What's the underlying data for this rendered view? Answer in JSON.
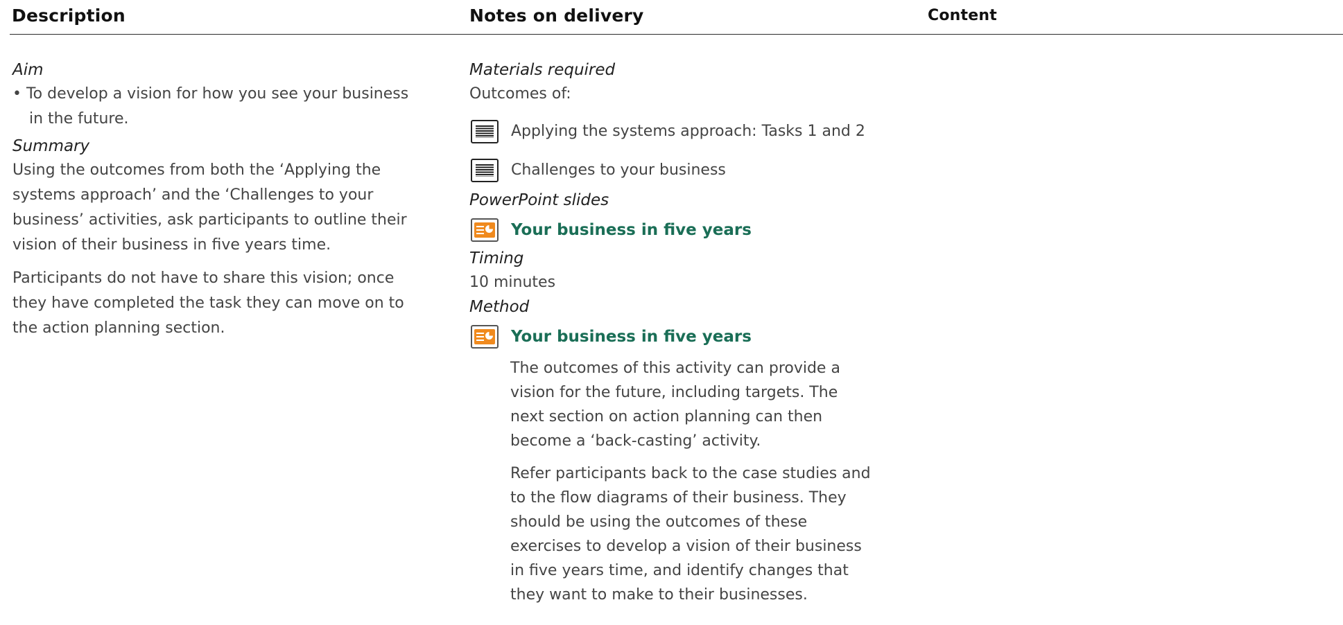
{
  "headers": {
    "description": "Description",
    "notes": "Notes on delivery",
    "content": "Content"
  },
  "description": {
    "aim_heading": "Aim",
    "aim_bullet": "• To develop a vision for how you see your business in the future.",
    "summary_heading": "Summary",
    "summary_p1": "Using the outcomes from both the ‘Applying the systems approach’ and the ‘Challenges to your business’ activities, ask participants to outline their vision of their business in five years time.",
    "summary_p2": "Participants do not have to share this vision; once they have completed the task they can move on to the action planning section."
  },
  "notes": {
    "materials_heading": "Materials required",
    "outcomes_of": "Outcomes of:",
    "material_items": [
      "Applying the systems approach: Tasks 1 and 2",
      "Challenges to your business"
    ],
    "slides_heading": "PowerPoint slides",
    "slide_title": "Your business in five years",
    "timing_heading": "Timing",
    "timing_value": "10 minutes",
    "method_heading": "Method",
    "method_slide_title": "Your business in five years",
    "method_p1": "The outcomes of this activity can provide a vision for the future, including targets. The next section on action planning can then become a ‘back-casting’ activity.",
    "method_p2": "Refer participants back to the case studies and to the flow diagrams of their business. They should be using the outcomes of these exercises to develop a vision of their business in five years time, and identify changes that they want to make to their businesses."
  },
  "icons": {
    "document": "document-icon",
    "powerpoint": "powerpoint-slide-icon"
  },
  "colors": {
    "slide_title": "#1a6e56",
    "ppt_icon": "#f08a1e"
  }
}
